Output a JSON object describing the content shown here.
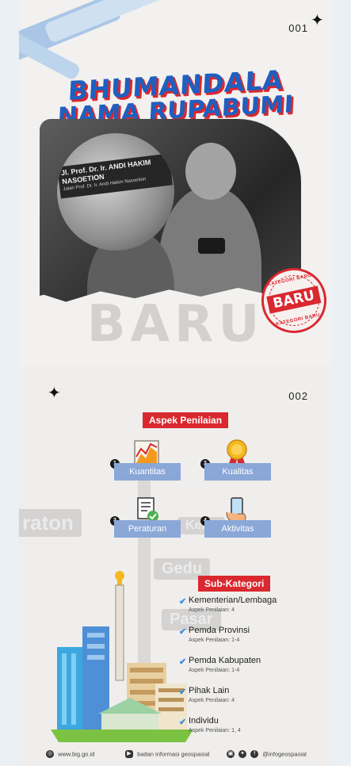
{
  "slide1": {
    "page_number": "001",
    "title_line1": "BHUMANDALA",
    "title_line2": "NAMA RUPABUMI",
    "street_sign_line1": "Jl. Prof. Dr. Ir. ANDI HAKIM NASOETION",
    "street_sign_line2": "Jalan Prof. Dr. Ir. Andi Hakim Nasoetion",
    "background_word": "BARU",
    "stamp": {
      "top_text": "KATEGORI BARU",
      "main_text": "BARU",
      "bottom_text": "KATEGORI BARU"
    }
  },
  "slide2": {
    "page_number": "002",
    "aspek_title": "Aspek Penilaian",
    "aspects": [
      {
        "number": "1",
        "label": "Kuantitas",
        "icon": "chart-icon"
      },
      {
        "number": "2",
        "label": "Kualitas",
        "icon": "medal-icon"
      },
      {
        "number": "3",
        "label": "Peraturan",
        "icon": "document-check-icon"
      },
      {
        "number": "4",
        "label": "Aktivitas",
        "icon": "phone-hand-icon"
      }
    ],
    "sub_title": "Sub-Kategori",
    "sub_categories": [
      {
        "name": "Kementerian/Lembaga",
        "detail": "Aspek Penilaian: 4"
      },
      {
        "name": "Pemda Provinsi",
        "detail": "Aspek Penilaian: 1-4"
      },
      {
        "name": "Pemda Kabupaten",
        "detail": "Aspek Penilaian: 1-4"
      },
      {
        "name": "Pihak Lain",
        "detail": "Aspek Penilaian: 4"
      },
      {
        "name": "Individu",
        "detail": "Aspek Penilaian: 1, 4"
      }
    ],
    "background_signs": [
      "raton",
      "Keng",
      "Gedu",
      "Pasar"
    ]
  },
  "footer": {
    "website": "www.big.go.id",
    "youtube": "badan informasi geospasial",
    "social_handle": "@infogeospasial"
  },
  "colors": {
    "title_blue": "#1f5fbf",
    "accent_red": "#d9282f",
    "aspect_bar": "#8aa7d8",
    "check_blue": "#3a8ce0"
  }
}
